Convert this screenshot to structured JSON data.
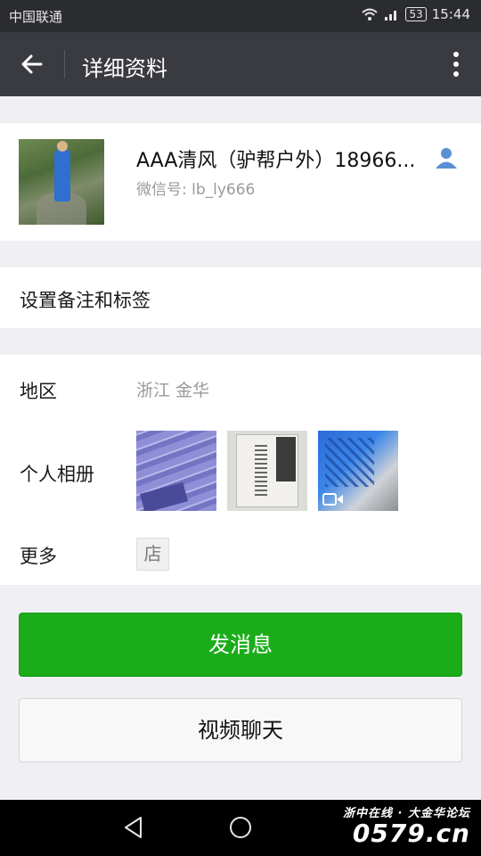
{
  "status_bar": {
    "carrier": "中国联通",
    "battery": "53",
    "time": "15:44"
  },
  "app_bar": {
    "title": "详细资料"
  },
  "profile": {
    "name": "AAA清风（驴帮户外）18966...",
    "wechat_id": "微信号: lb_ly666"
  },
  "remark": {
    "label": "设置备注和标签"
  },
  "info": {
    "region_label": "地区",
    "region_value": "浙江  金华",
    "album_label": "个人相册",
    "more_label": "更多",
    "shop_glyph": "店"
  },
  "actions": {
    "send_message": "发消息",
    "video_chat": "视频聊天"
  },
  "watermark": {
    "line1": "浙中在线 · 大金华论坛",
    "line2": "0579.cn"
  },
  "colors": {
    "primary_green": "#1aad19",
    "app_bar": "#3a3b40",
    "status_bar": "#2b2c30"
  },
  "icons": [
    "back-arrow-icon",
    "more-vertical-icon",
    "contact-person-icon",
    "video-icon",
    "shop-icon",
    "nav-back-icon",
    "nav-home-icon"
  ]
}
